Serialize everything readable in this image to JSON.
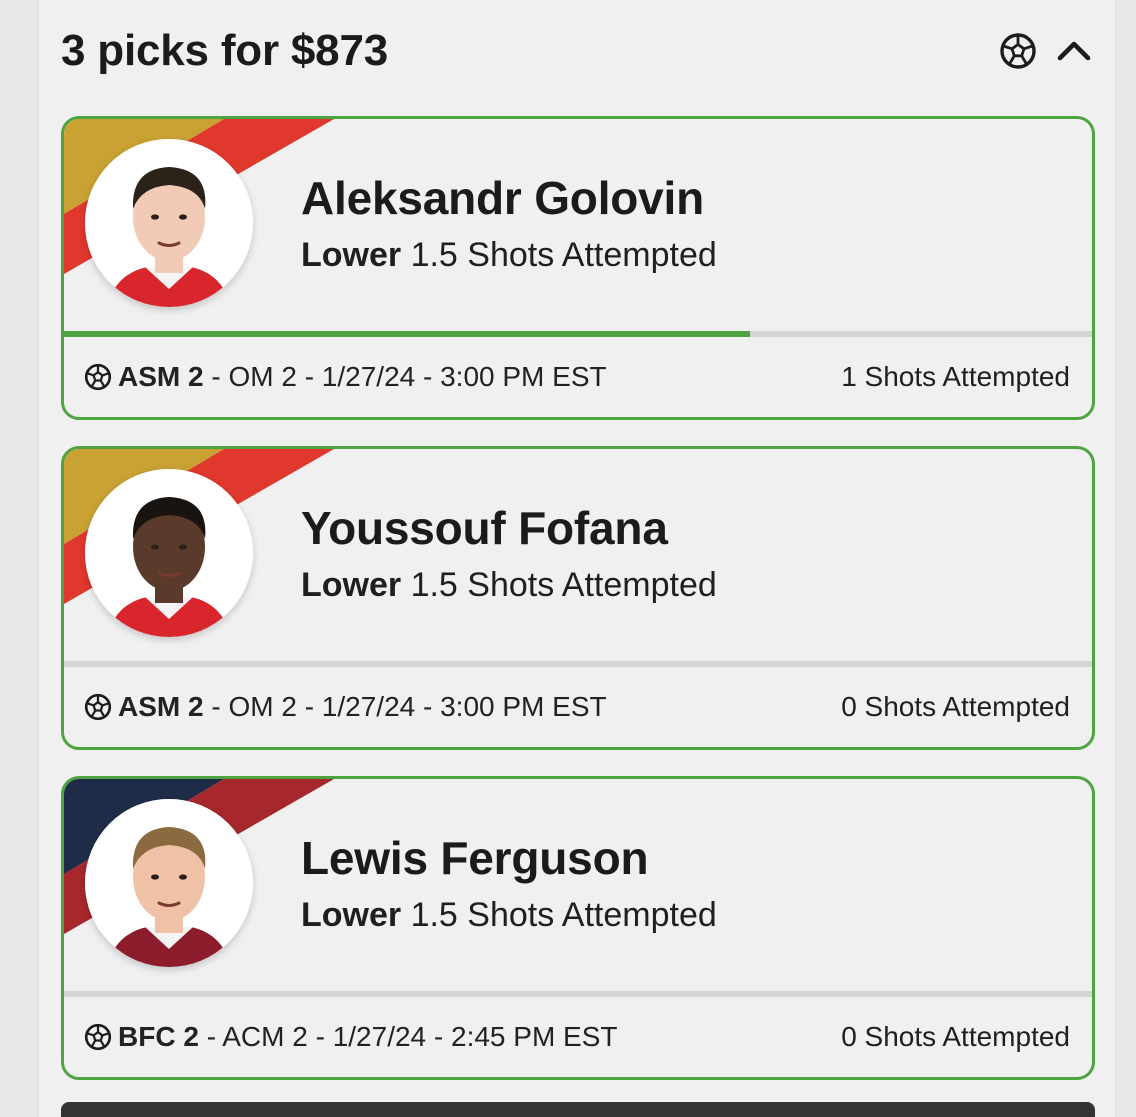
{
  "header": {
    "title": "3 picks for $873",
    "sport_icon": "soccer-ball-icon",
    "collapse_icon": "chevron-up-icon"
  },
  "picks": [
    {
      "player_name": "Aleksandr Golovin",
      "direction": "Lower",
      "line": "1.5",
      "stat": "Shots Attempted",
      "team1": "ASM 2",
      "game_rest": "- OM 2 - 1/27/24 - 3:00 PM EST",
      "current_stat": "1 Shots Attempted",
      "progress": 0.667,
      "stripe_colors": [
        "#c9a233",
        "#e1382d"
      ],
      "jersey_color": "#d8262c",
      "skin_color": "#f1cbb5",
      "hair_color": "#2b2219"
    },
    {
      "player_name": "Youssouf Fofana",
      "direction": "Lower",
      "line": "1.5",
      "stat": "Shots Attempted",
      "team1": "ASM 2",
      "game_rest": "- OM 2 - 1/27/24 - 3:00 PM EST",
      "current_stat": "0 Shots Attempted",
      "progress": 0,
      "stripe_colors": [
        "#c9a233",
        "#e1382d"
      ],
      "jersey_color": "#d8262c",
      "skin_color": "#5a3a2a",
      "hair_color": "#1a1410"
    },
    {
      "player_name": "Lewis Ferguson",
      "direction": "Lower",
      "line": "1.5",
      "stat": "Shots Attempted",
      "team1": "BFC 2",
      "game_rest": "- ACM 2 - 1/27/24 - 2:45 PM EST",
      "current_stat": "0 Shots Attempted",
      "progress": 0,
      "stripe_colors": [
        "#1f2c48",
        "#a6282c"
      ],
      "jersey_color": "#8c1c2c",
      "skin_color": "#efc2a8",
      "hair_color": "#8a6a3e"
    }
  ]
}
